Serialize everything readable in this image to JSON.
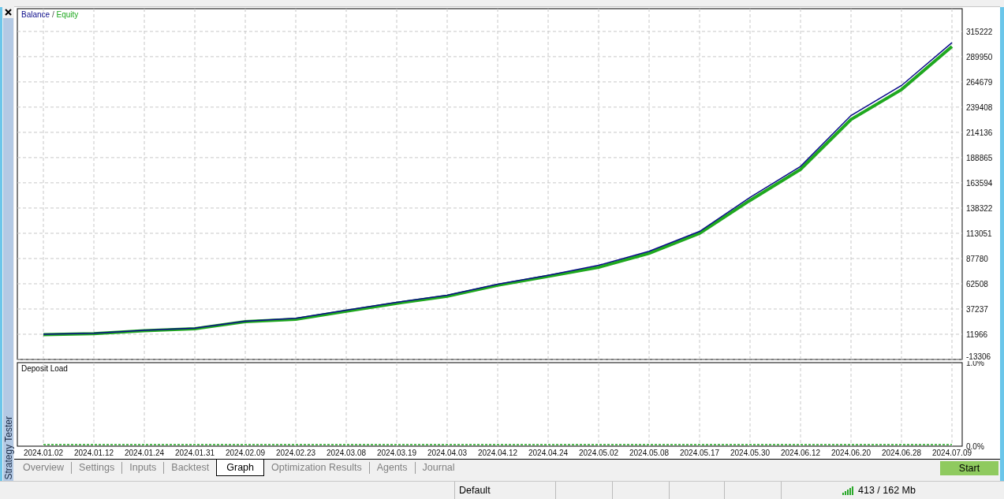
{
  "side_panel": {
    "title": "Strategy Tester"
  },
  "balance_chart": {
    "legend_separator": "/",
    "chart_data": {
      "type": "line",
      "grid": true,
      "series": [
        {
          "name": "Balance",
          "color": "#0a0a8a",
          "values": [
            12000,
            13000,
            16000,
            18000,
            25000,
            28000,
            36000,
            44000,
            51000,
            62000,
            71000,
            81000,
            95000,
            115000,
            149000,
            180000,
            231000,
            261000,
            304000
          ]
        },
        {
          "name": "Equity",
          "color": "#1fa81f",
          "values": [
            11500,
            12500,
            15500,
            17500,
            24500,
            27000,
            35000,
            43000,
            50000,
            61000,
            70000,
            79000,
            93000,
            113000,
            146000,
            177000,
            227000,
            257000,
            300000
          ]
        }
      ],
      "ylim": [
        -13306,
        338000
      ],
      "yticks": [
        315222,
        289950,
        264679,
        239408,
        214136,
        188865,
        163594,
        138322,
        113051,
        87780,
        62508,
        37237,
        11966,
        -13306
      ]
    }
  },
  "deposit_chart": {
    "chart_data": {
      "type": "line",
      "title": "Deposit Load",
      "grid": true,
      "categories": [
        "2024.01.02",
        "2024.01.12",
        "2024.01.24",
        "2024.01.31",
        "2024.02.09",
        "2024.02.23",
        "2024.03.08",
        "2024.03.19",
        "2024.04.03",
        "2024.04.12",
        "2024.04.24",
        "2024.05.02",
        "2024.05.08",
        "2024.05.17",
        "2024.05.30",
        "2024.06.12",
        "2024.06.20",
        "2024.06.28",
        "2024.07.09"
      ],
      "series": [
        {
          "color": "#1fa81f",
          "line_style": "dotted",
          "values": [
            0.02,
            0.02,
            0.02,
            0.02,
            0.02,
            0.02,
            0.02,
            0.02,
            0.02,
            0.02,
            0.02,
            0.02,
            0.02,
            0.02,
            0.02,
            0.02,
            0.02,
            0.02,
            0.02
          ]
        }
      ],
      "ylim": [
        0,
        1
      ],
      "yticks": [
        {
          "value": 1,
          "label": "1.0%"
        },
        {
          "value": 0,
          "label": "0.0%"
        }
      ]
    }
  },
  "tabs": [
    {
      "label": "Overview",
      "selected": false
    },
    {
      "label": "Settings",
      "selected": false
    },
    {
      "label": "Inputs",
      "selected": false
    },
    {
      "label": "Backtest",
      "selected": false
    },
    {
      "label": "Graph",
      "selected": true
    },
    {
      "label": "Optimization Results",
      "selected": false
    },
    {
      "label": "Agents",
      "selected": false
    },
    {
      "label": "Journal",
      "selected": false
    }
  ],
  "start_button": {
    "label": "Start"
  },
  "status_bar": {
    "profile": "Default",
    "memory": "413 / 162 Mb"
  }
}
